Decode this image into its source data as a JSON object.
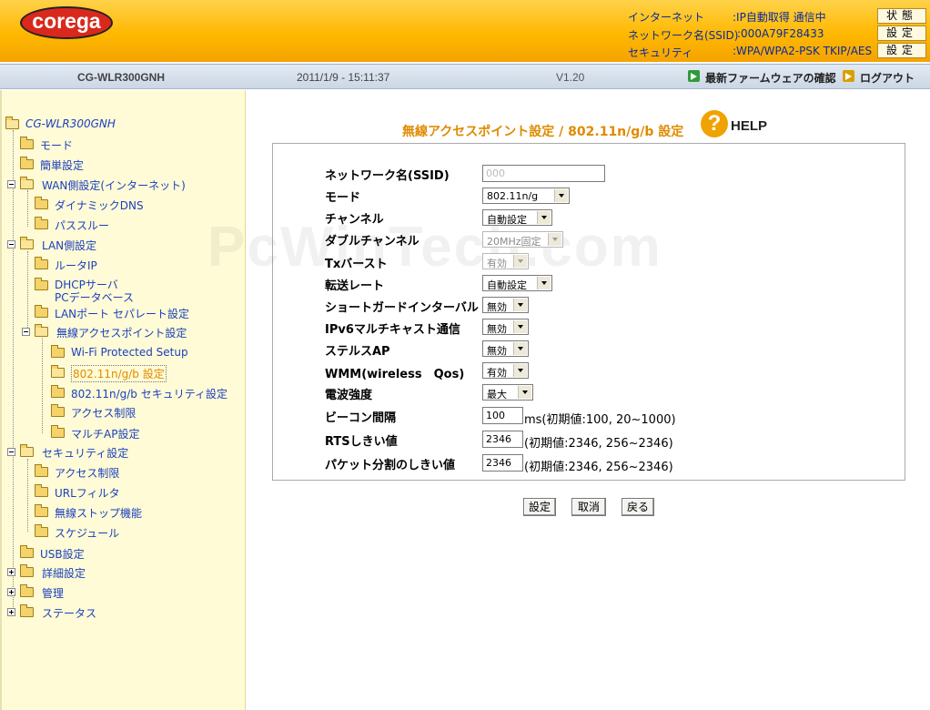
{
  "header": {
    "logo_text": "corega",
    "status": [
      {
        "label": "インターネット",
        "value": ":IP自動取得 通信中",
        "button": "状態"
      },
      {
        "label": "ネットワーク名(SSID)",
        "value": ":000A79F28433",
        "button": "設定"
      },
      {
        "label": "セキュリティ",
        "value": ":WPA/WPA2-PSK TKIP/AES",
        "button": "設定"
      }
    ]
  },
  "infobar": {
    "model": "CG-WLR300GNH",
    "datetime": "2011/1/9 - 15:11:37",
    "version": "V1.20",
    "firmware_link": "最新ファームウェアの確認",
    "logout_link": "ログアウト"
  },
  "sidebar": {
    "root": "CG-WLR300GNH",
    "items": [
      {
        "label": "モード"
      },
      {
        "label": "簡単設定"
      },
      {
        "label": "WAN側設定(インターネット)"
      },
      {
        "label": "ダイナミックDNS"
      },
      {
        "label": "パススルー"
      },
      {
        "label": "LAN側設定"
      },
      {
        "label": "ルータIP"
      },
      {
        "label": "DHCPサーバ"
      },
      {
        "label": "PCデータベース"
      },
      {
        "label": "LANポート セパレート設定"
      },
      {
        "label": "無線アクセスポイント設定"
      },
      {
        "label": "Wi-Fi Protected Setup"
      },
      {
        "label": "802.11n/g/b 設定"
      },
      {
        "label": "802.11n/g/b セキュリティ設定"
      },
      {
        "label": "アクセス制限"
      },
      {
        "label": "マルチAP設定"
      },
      {
        "label": "セキュリティ設定"
      },
      {
        "label": "アクセス制限"
      },
      {
        "label": "URLフィルタ"
      },
      {
        "label": "無線ストップ機能"
      },
      {
        "label": "スケジュール"
      },
      {
        "label": "USB設定"
      },
      {
        "label": "詳細設定"
      },
      {
        "label": "管理"
      },
      {
        "label": "ステータス"
      }
    ]
  },
  "main": {
    "title": "無線アクセスポイント設定 / 802.11n/g/b 設定",
    "help_label": "HELP",
    "watermark": "PcWinTech.com",
    "rows": [
      {
        "label": "ネットワーク名(SSID)",
        "value": "000"
      },
      {
        "label": "モード",
        "value": "802.11n/g"
      },
      {
        "label": "チャンネル",
        "value": "自動設定"
      },
      {
        "label": "ダブルチャンネル",
        "value": "20MHz固定"
      },
      {
        "label": "Txバースト",
        "value": "有効"
      },
      {
        "label": "転送レート",
        "value": "自動設定"
      },
      {
        "label": "ショートガードインターバル",
        "value": "無効"
      },
      {
        "label": "IPv6マルチキャスト通信",
        "value": "無効"
      },
      {
        "label": "ステルスAP",
        "value": "無効"
      },
      {
        "label": "WMM(wireless　Qos)",
        "value": "有効"
      },
      {
        "label": "電波強度",
        "value": "最大"
      },
      {
        "label": "ビーコン間隔",
        "value": "100",
        "hint": "ms(初期値:100, 20~1000)"
      },
      {
        "label": "RTSしきい値",
        "value": "2346",
        "hint": "(初期値:2346, 256~2346)"
      },
      {
        "label": "パケット分割のしきい値",
        "value": "2346",
        "hint": "(初期値:2346, 256~2346)"
      }
    ],
    "buttons": {
      "save": "設定",
      "cancel": "取消",
      "back": "戻る"
    }
  },
  "colors": {
    "header_top": "#ffd24a",
    "header_bottom": "#f5a300",
    "sidebar_bg": "#fffbd6",
    "title": "#e08a00",
    "link": "#1a3fbf"
  }
}
